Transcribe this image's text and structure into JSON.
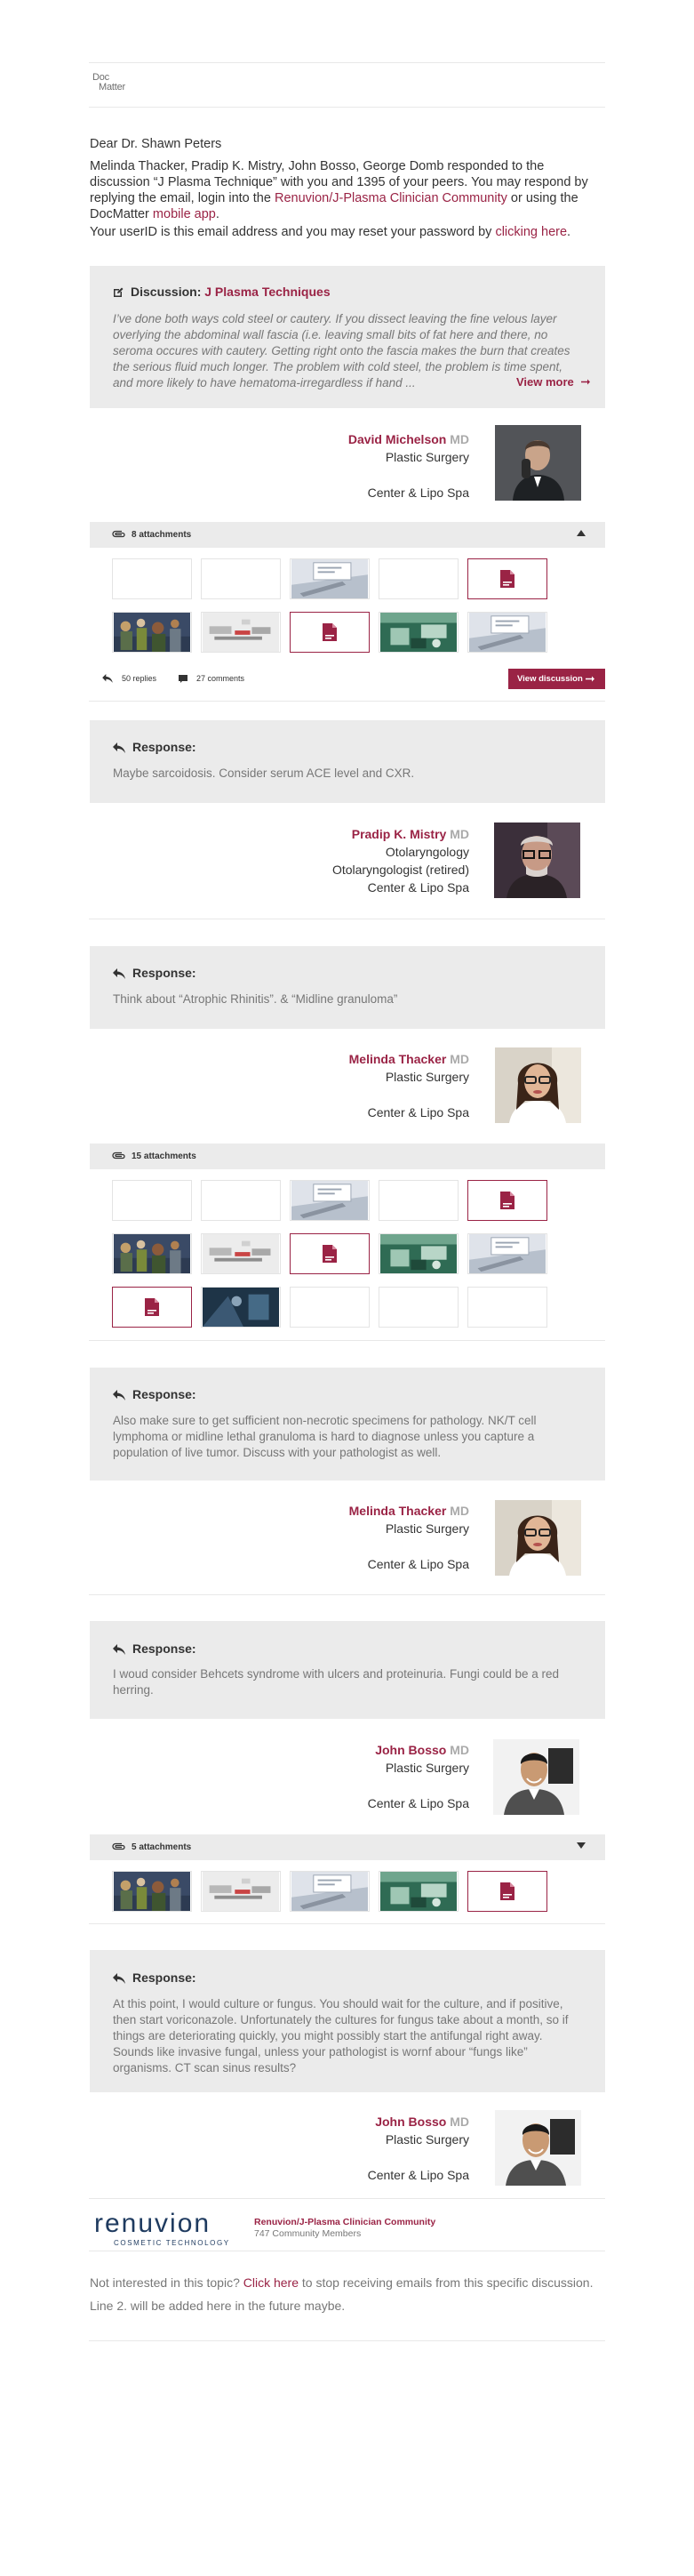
{
  "brand": {
    "logo_line1": "Doc",
    "logo_line2": "Matter",
    "accent": "#9a2345"
  },
  "greeting": "Dear Dr. Shawn Peters",
  "intro": {
    "text1": "Melinda Thacker, Pradip K. Mistry, John Bosso, George Domb responded to the discussion “J Plasma Technique” with you and 1395 of your peers. You may respond by replying the email, login into the ",
    "community_link": "Renuvion/J-Plasma Clinician Community",
    "text2": " or using the DocMatter ",
    "mobile_link": "mobile app",
    "text3": "."
  },
  "userid": {
    "text": "Your userID is this email address and you may reset your password by ",
    "link": "clicking here",
    "end": "."
  },
  "discussion": {
    "label": "Discussion:",
    "title": "J Plasma Techniques",
    "body": "I’ve done both ways cold steel or cautery. If you dissect leaving the fine velous layer overlying the abdominal wall fascia (i.e. leaving small bits of fat here and there, no seroma occures with cautery. Getting right onto the fascia makes the burn that creates the serious fluid much longer. The problem with cold steel, the problem is time spent, and more likely to have hematoma-irregardless if hand ...",
    "view_more": "View more",
    "author": {
      "name": "David Michelson",
      "degree": "MD",
      "line1": "Plastic Surgery",
      "line2": "",
      "line3": "Center & Lipo Spa"
    },
    "attachments_label": "8 attachments",
    "replies": "50 replies",
    "comments": "27 comments",
    "view_button": "View discussion"
  },
  "responses": [
    {
      "label": "Response:",
      "body": "Maybe sarcoidosis. Consider serum ACE level and CXR.",
      "author": {
        "name": "Pradip K. Mistry",
        "degree": "MD",
        "line1": "Otolaryngology",
        "line2": "Otolaryngologist (retired)",
        "line3": "Center & Lipo Spa"
      }
    },
    {
      "label": "Response:",
      "body": "Think about “Atrophic Rhinitis”. & “Midline granuloma”",
      "author": {
        "name": "Melinda Thacker",
        "degree": "MD",
        "line1": "Plastic Surgery",
        "line2": "",
        "line3": "Center & Lipo Spa"
      },
      "attachments_label": "15 attachments"
    },
    {
      "label": "Response:",
      "body": "Also make sure to get sufficient non-necrotic specimens for pathology. NK/T cell lymphoma or midline lethal granuloma is hard to diagnose unless you capture a population of live tumor. Discuss with your pathologist as well.",
      "author": {
        "name": "Melinda Thacker",
        "degree": "MD",
        "line1": "Plastic Surgery",
        "line2": "",
        "line3": "Center & Lipo Spa"
      }
    },
    {
      "label": "Response:",
      "body": "I woud consider Behcets syndrome with ulcers and proteinuria. Fungi could be a red herring.",
      "author": {
        "name": "John Bosso",
        "degree": "MD",
        "line1": "Plastic Surgery",
        "line2": "",
        "line3": "Center & Lipo Spa"
      },
      "attachments_label": "5 attachments"
    },
    {
      "label": "Response:",
      "body": "At this point, I would culture or fungus. You should wait for the culture, and if positive, then start voriconazole. Unfortunately the cultures for fungus take about a month, so if things are deteriorating quickly, you might possibly start the antifungal right away. Sounds like invasive fungal, unless your pathologist is wornf abour “fungs like” organisms. CT scan sinus results?",
      "author": {
        "name": "John Bosso",
        "degree": "MD",
        "line1": "Plastic Surgery",
        "line2": "",
        "line3": "Center & Lipo Spa"
      }
    }
  ],
  "footer": {
    "logo_text": "renuvion",
    "logo_tagline": "COSMETIC TECHNOLOGY",
    "community": "Renuvion/J-Plasma Clinician Community",
    "members": "747 Community Members",
    "unsub_text1": "Not interested in this topic? ",
    "unsub_link": "Click here",
    "unsub_text2": " to stop receiving emails from this specific discussion.",
    "line2": "Line 2. will be added here in the future maybe."
  }
}
